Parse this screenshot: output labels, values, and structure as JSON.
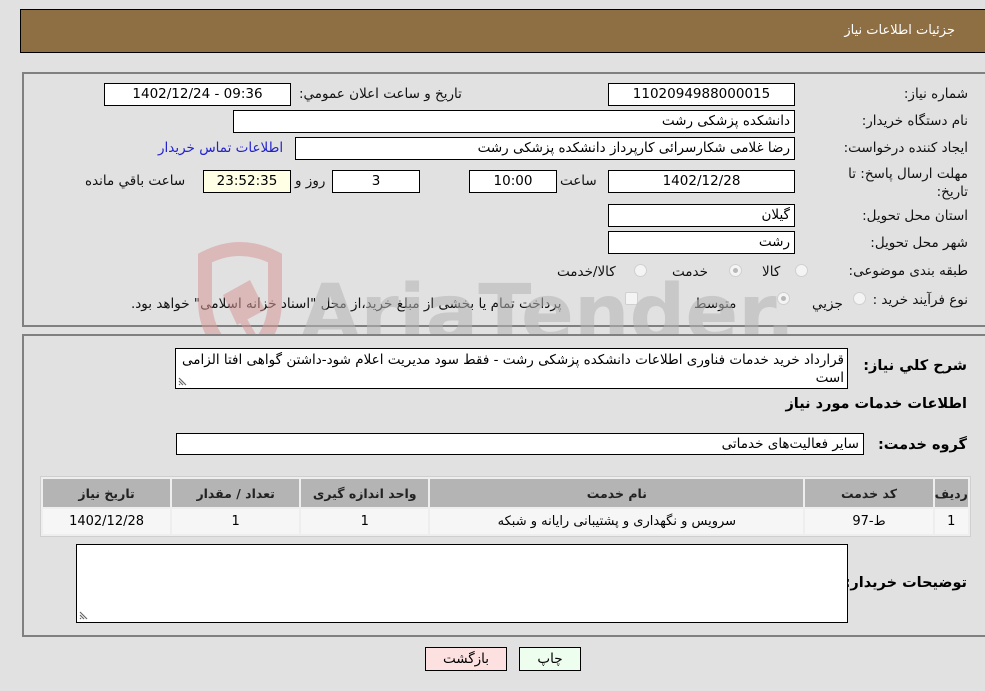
{
  "header": {
    "title": "جزئیات اطلاعات نیاز"
  },
  "details": {
    "need_number": {
      "label": "شماره نیاز:",
      "value": "1102094988000015"
    },
    "announce_datetime": {
      "label": "تاریخ و ساعت اعلان عمومي:",
      "value": "1402/12/24 - 09:36"
    },
    "buyer_org": {
      "label": "نام دستگاه خریدار:",
      "value": "دانشکده پزشکی رشت"
    },
    "requester": {
      "label": "ایجاد کننده درخواست:",
      "value": "رضا غلامی شکارسرائی کارپرداز دانشکده پزشکی رشت"
    },
    "buyer_contact_link": "اطلاعات تماس خریدار",
    "deadline": {
      "label": "مهلت ارسال پاسخ: تا تاریخ:",
      "date": "1402/12/28",
      "time_label": "ساعت",
      "time": "10:00",
      "days": "3",
      "days_label": "روز و",
      "remaining": "23:52:35",
      "remaining_label": "ساعت باقي مانده"
    },
    "province": {
      "label": "استان محل تحویل:",
      "value": "گیلان"
    },
    "city": {
      "label": "شهر محل تحویل:",
      "value": "رشت"
    },
    "category": {
      "label": "طبقه بندی موضوعی:",
      "options": [
        "کالا",
        "خدمت",
        "کالا/خدمت"
      ],
      "selected": "خدمت"
    },
    "purchase_type": {
      "label": "نوع فرآیند خرید :",
      "options": [
        "جزيي",
        "متوسط"
      ],
      "selected": "متوسط",
      "treasury_note": "پرداخت تمام یا بخشی از مبلغ خرید،از محل \"اسناد خزانه اسلامی\" خواهد بود."
    }
  },
  "description": {
    "label": "شرح کلي نیاز:",
    "value": "قرارداد خرید خدمات فناوری اطلاعات دانشکده پزشکی رشت - فقط سود مدیریت اعلام شود-داشتن گواهی افتا الزامی است"
  },
  "services_section": {
    "title": "اطلاعات خدمات مورد نیاز",
    "group_label": "گروه خدمت:",
    "group_value": "سایر فعالیت‌های خدماتی",
    "table": {
      "headers": [
        "ردیف",
        "کد خدمت",
        "نام خدمت",
        "واحد اندازه گیری",
        "تعداد / مقدار",
        "تاریخ نیاز"
      ],
      "rows": [
        [
          "1",
          "ط-97",
          "سرویس و نگهداری و پشتیبانی رایانه و شبکه",
          "1",
          "1",
          "1402/12/28"
        ]
      ]
    }
  },
  "buyer_notes": {
    "label": "توضیحات خریدار:",
    "value": ""
  },
  "buttons": {
    "print": "چاپ",
    "back": "بازگشت"
  },
  "watermark": {
    "text": "AriaTender.neT"
  }
}
